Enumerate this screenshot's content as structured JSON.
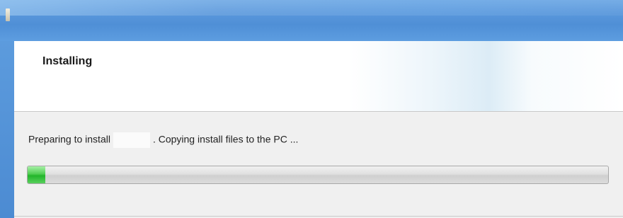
{
  "window": {
    "header": {
      "title": "Installing"
    },
    "status": {
      "prefix": "Preparing to install",
      "suffix": ". Copying install files to the PC ..."
    },
    "progress": {
      "fraction": 0.03,
      "fill_color": "#3fc444"
    },
    "colors": {
      "titlebar": "#5a98dc",
      "banner": "#ffffff",
      "body": "#f0f0f0"
    }
  }
}
